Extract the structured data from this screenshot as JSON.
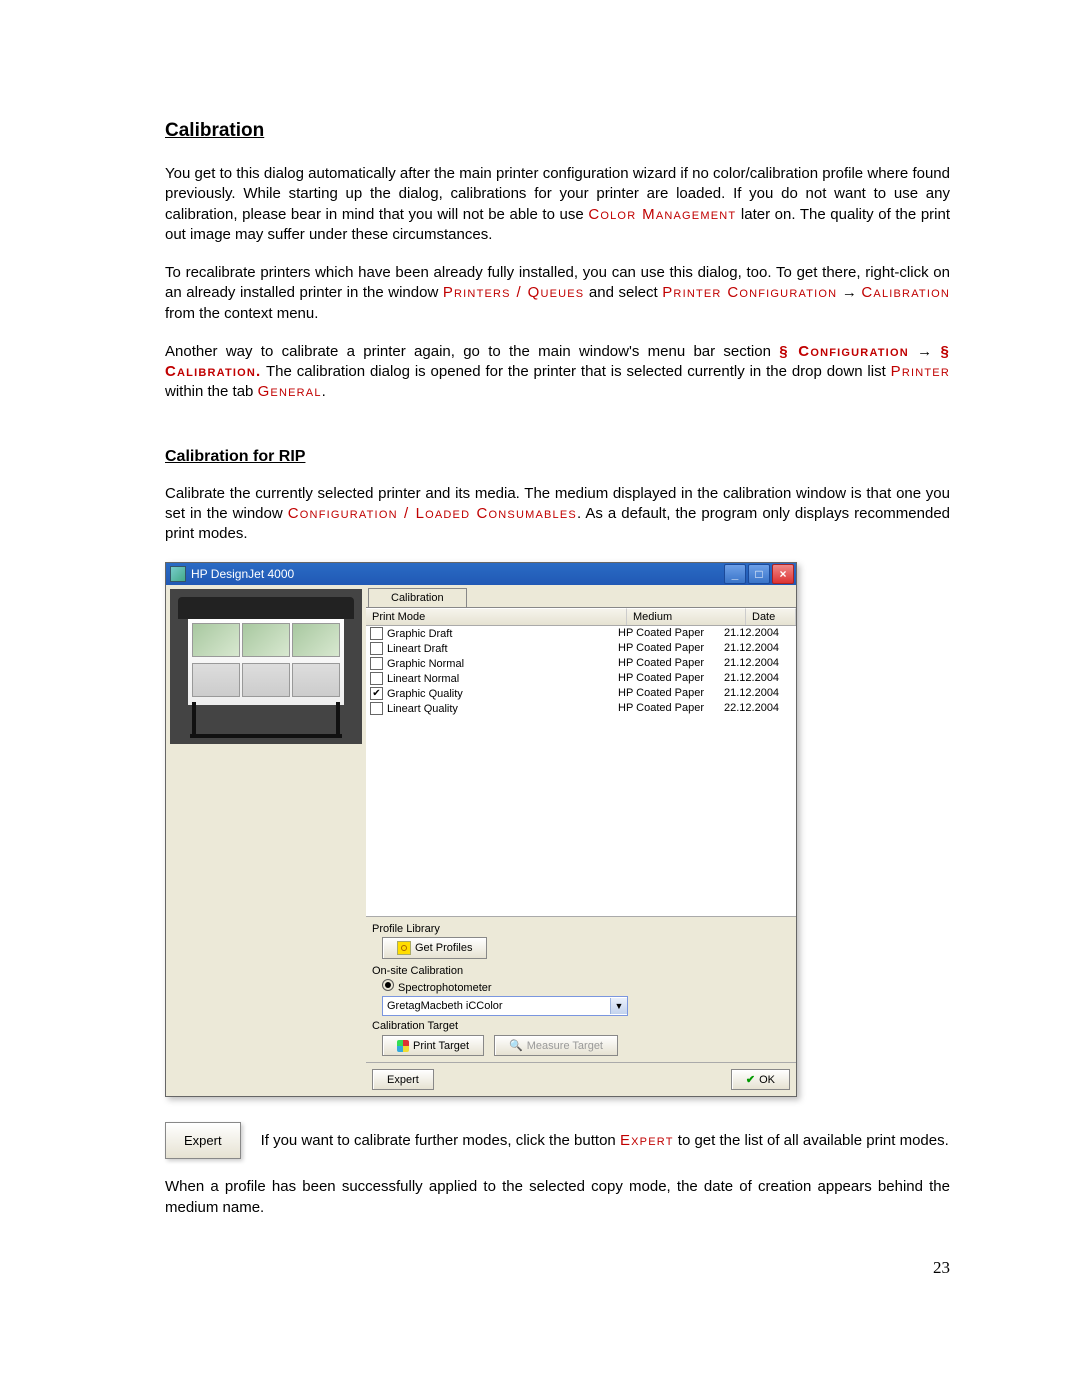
{
  "page_number": "23",
  "h1": "Calibration",
  "p1a": "You get to this dialog automatically after the main printer configuration wizard if no color/calibration profile where found previously. While starting up the dialog, calibrations for your printer are loaded. If you do not want to use any calibration, please bear in mind that you will not be able to use ",
  "p1_uc1": "Color Management",
  "p1b": " later on. The quality of the print out image may suffer under these circumstances.",
  "p2a": "To recalibrate printers which have been already fully installed, you can use this dialog, too. To get there, right-click on an already installed printer in the window ",
  "p2_uc1": "Printers / Queues",
  "p2b": " and select ",
  "p2_uc2": "Printer Configuration",
  "p2_arrow1": " → ",
  "p2_uc3": "Calibration",
  "p2c": " from the context menu.",
  "p3a": "Another way to calibrate a printer again, go to the main window's menu bar section ",
  "p3_uc1": "§ Configuration",
  "p3_arrow1": " → ",
  "p3_uc2": "§ Calibration.",
  "p3b": " The calibration dialog is opened for the printer that is selected currently in the drop down list ",
  "p3_uc3": "Printer",
  "p3c": " within the tab ",
  "p3_uc4": "General",
  "p3d": ".",
  "h2": "Calibration for RIP",
  "p4a": "Calibrate the currently selected printer and its media. The medium displayed in the calibration window is that one you set in the window ",
  "p4_uc1": "Configuration / Loaded Consumables",
  "p4b": ". As a default, the program only displays recommended print modes.",
  "window": {
    "title": "HP DesignJet 4000",
    "tab": "Calibration",
    "headers": {
      "mode": "Print Mode",
      "medium": "Medium",
      "date": "Date"
    },
    "rows": [
      {
        "label": "Graphic Draft",
        "checked": false,
        "medium": "HP Coated Paper",
        "date": "21.12.2004"
      },
      {
        "label": "Lineart Draft",
        "checked": false,
        "medium": "HP Coated Paper",
        "date": "21.12.2004"
      },
      {
        "label": "Graphic Normal",
        "checked": false,
        "medium": "HP Coated Paper",
        "date": "21.12.2004"
      },
      {
        "label": "Lineart Normal",
        "checked": false,
        "medium": "HP Coated Paper",
        "date": "21.12.2004"
      },
      {
        "label": "Graphic Quality",
        "checked": true,
        "medium": "HP Coated Paper",
        "date": "21.12.2004"
      },
      {
        "label": "Lineart Quality",
        "checked": false,
        "medium": "HP Coated Paper",
        "date": "22.12.2004"
      }
    ],
    "profile_library": "Profile Library",
    "get_profiles": "Get Profiles",
    "onsite": "On-site Calibration",
    "spectro": "Spectrophotometer",
    "dropdown": "GretagMacbeth iCColor",
    "cal_target": "Calibration Target",
    "print_target": "Print Target",
    "measure_target": "Measure Target",
    "expert": "Expert",
    "ok": "OK"
  },
  "callout": {
    "btn": "Expert",
    "a": "If you want to calibrate further modes, click the button ",
    "uc": "Expert",
    "b": " to get the list of all available print modes."
  },
  "p5": "When a profile has been successfully applied to the selected copy mode, the date of creation appears behind the medium name."
}
